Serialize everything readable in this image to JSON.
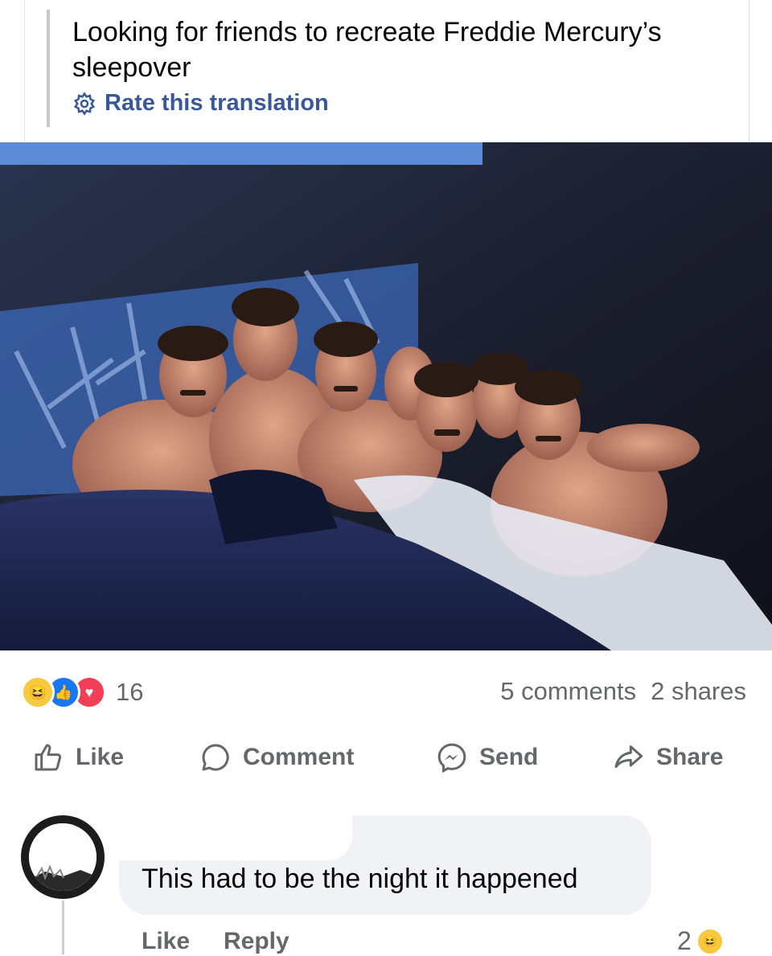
{
  "post": {
    "text": "Looking for friends to recreate Freddie Mercury’s sleepover",
    "rate_label": "Rate this translation",
    "image_alt": "Photo of several shirtless men lying together in a bed under dark blue sheets"
  },
  "stats": {
    "reaction_icons": [
      "haha-icon",
      "like-icon",
      "love-icon"
    ],
    "reaction_count": "16",
    "comments": "5 comments",
    "shares": "2 shares"
  },
  "actions": {
    "like": "Like",
    "comment": "Comment",
    "send": "Send",
    "share": "Share"
  },
  "comment": {
    "text": "This had to be the night it happened",
    "like": "Like",
    "reply": "Reply",
    "reaction_count": "2"
  },
  "colors": {
    "link_blue": "#385898",
    "muted": "#65676b",
    "bubble": "#f0f2f5",
    "like_blue": "#1877f2",
    "love_red": "#f33e58",
    "haha_yellow": "#f7c93f"
  }
}
